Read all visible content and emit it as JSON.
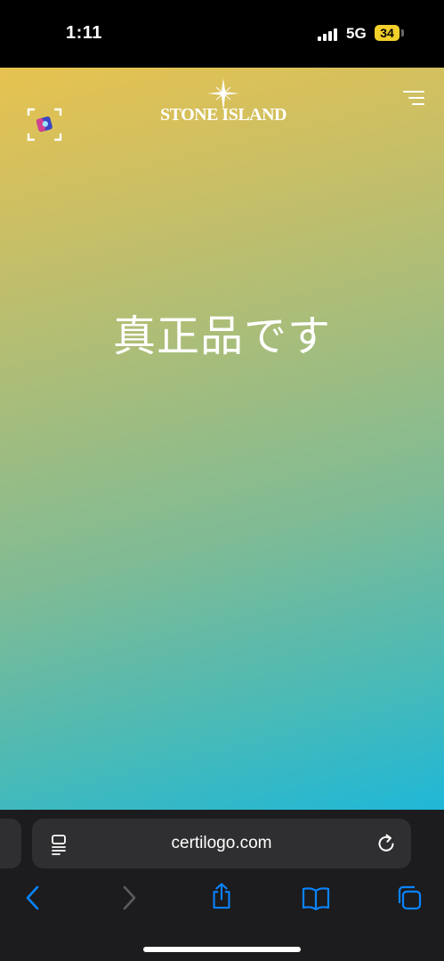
{
  "status_bar": {
    "time": "1:11",
    "network": "5G",
    "battery": "34"
  },
  "site": {
    "logo_text": "STONE ISLAND",
    "headline": "真正品です"
  },
  "browser": {
    "url": "certilogo.com"
  },
  "colors": {
    "gradient_top": "#e7c24f",
    "gradient_bottom": "#1fb7d7",
    "toolbar_bg": "#1c1c1e",
    "accent_blue": "#0a84ff",
    "battery_yellow": "#f2cf2a"
  },
  "icons": {
    "scan": "scan-frame-icon",
    "menu": "hamburger-menu-icon",
    "page_menu": "page-menu-icon",
    "reload": "reload-icon",
    "back": "chevron-left-icon",
    "forward": "chevron-right-icon",
    "share": "share-icon",
    "bookmarks": "book-icon",
    "tabs": "tabs-icon"
  }
}
